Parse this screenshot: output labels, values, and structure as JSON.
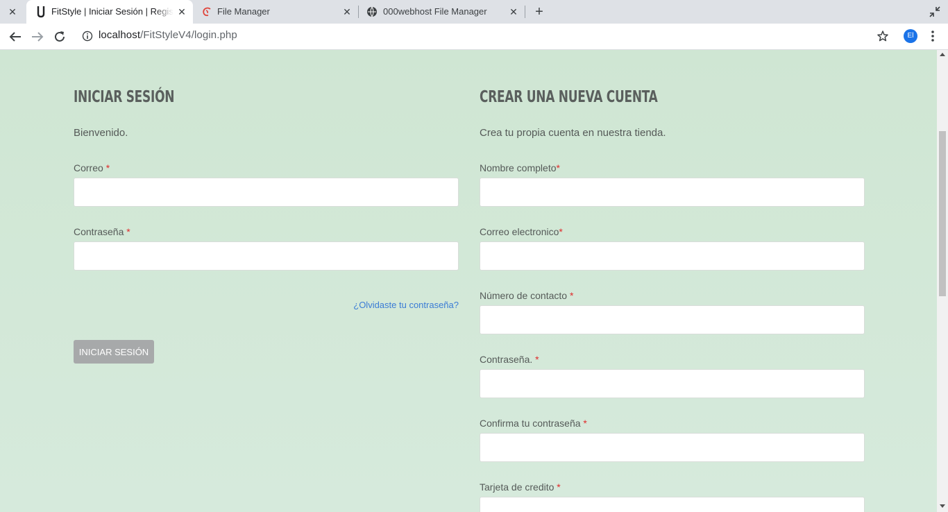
{
  "browser": {
    "tabs": [
      {
        "title": "",
        "active": false
      },
      {
        "title": "FitStyle | Iniciar Sesión | Registro",
        "active": true,
        "icon": "fitstyle-favicon"
      },
      {
        "title": "File Manager",
        "active": false,
        "icon": "file-manager-favicon"
      },
      {
        "title": "000webhost File Manager",
        "active": false,
        "icon": "globe-icon"
      }
    ],
    "url_host": "localhost",
    "url_path": "/FitStyleV4/login.php",
    "profile_initials": "El"
  },
  "login": {
    "title": "INICIAR SESIÓN",
    "intro": "Bienvenido.",
    "fields": [
      {
        "label": "Correo",
        "required_mark": "*",
        "value": ""
      },
      {
        "label": "Contraseña",
        "required_mark": "*",
        "value": ""
      }
    ],
    "forgot_link": "¿Olvidaste tu contraseña?",
    "submit_label": "INICIAR SESIÓN"
  },
  "register": {
    "title": "CREAR UNA NUEVA CUENTA",
    "intro": "Crea tu propia cuenta en nuestra tienda.",
    "fields": [
      {
        "label": "Nombre completo",
        "required_mark": "*",
        "value": ""
      },
      {
        "label": "Correo electronico",
        "required_mark": "*",
        "value": ""
      },
      {
        "label": "Número de contacto",
        "required_mark": "*",
        "value": ""
      },
      {
        "label": "Contraseña.",
        "required_mark": "*",
        "value": ""
      },
      {
        "label": "Confirma tu contraseña",
        "required_mark": "*",
        "value": ""
      },
      {
        "label": "Tarjeta de credito",
        "required_mark": "*",
        "value": ""
      }
    ]
  },
  "colors": {
    "page_background": "#cfe6d3",
    "required_mark": "#e02b2b",
    "link": "#3a7bd5",
    "button": "#a7a9aa"
  }
}
